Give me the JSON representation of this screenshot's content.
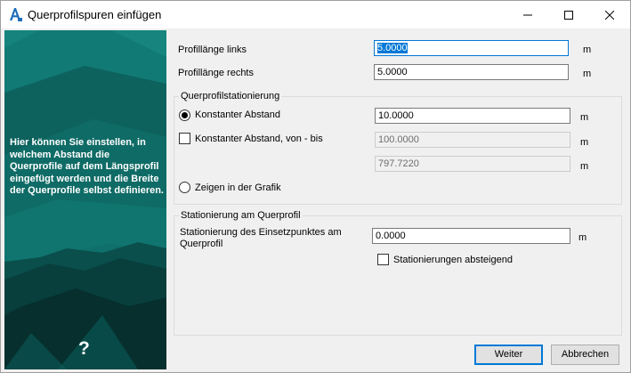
{
  "window": {
    "title": "Querprofilspuren einfügen",
    "icon": "autocad-a-icon",
    "controls": {
      "minimize": "—",
      "maximize": "☐",
      "close": "✕"
    }
  },
  "sidebar": {
    "text": "Hier können Sie einstellen, in welchem Abstand die Querprofile auf dem Längsprofil eingefügt werden und die Breite der Querprofile selbst definieren.",
    "help": "?",
    "background_color": "#0e6a66"
  },
  "profile": {
    "left_label": "Profillänge links",
    "left_value": "5.0000",
    "right_label": "Profillänge rechts",
    "right_value": "5.0000",
    "unit": "m"
  },
  "stationing": {
    "group_title": "Querprofilstationierung",
    "constant_label": "Konstanter Abstand",
    "constant_value": "10.0000",
    "constant_selected": true,
    "range_label": "Konstanter Abstand, von - bis",
    "range_checked": false,
    "range_from": "100.0000",
    "range_to": "797.7220",
    "graphic_label": "Zeigen in der Grafik",
    "graphic_selected": false,
    "unit": "m"
  },
  "cross_stationing": {
    "group_title": "Stationierung am Querprofil",
    "insert_label_line1": "Stationierung des Einsetzpunktes am",
    "insert_label_line2": "Querprofil",
    "insert_value": "0.0000",
    "descending_label": "Stationierungen absteigend",
    "descending_checked": false,
    "unit": "m"
  },
  "buttons": {
    "next": "Weiter",
    "cancel": "Abbrechen"
  },
  "colors": {
    "accent": "#0078d7",
    "teal": "#0e6a66"
  }
}
